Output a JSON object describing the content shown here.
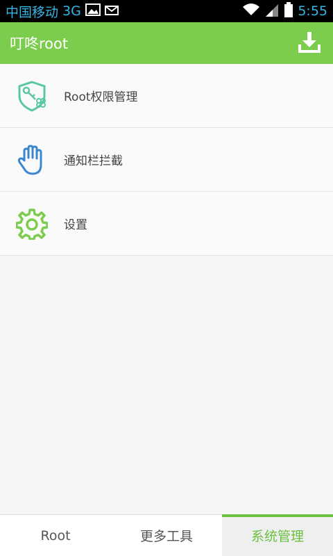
{
  "status_bar": {
    "carrier": "中国移动",
    "network": "3G",
    "time": "5:55",
    "icons": [
      "gallery-icon",
      "mail-icon",
      "wifi-icon",
      "signal-icon",
      "battery-icon"
    ]
  },
  "app_bar": {
    "title": "叮咚root",
    "action_icon": "download-icon"
  },
  "menu": {
    "items": [
      {
        "label": "Root权限管理",
        "icon": "shield-key-icon",
        "color": "#5ac8a0"
      },
      {
        "label": "通知栏拦截",
        "icon": "hand-icon",
        "color": "#3a86d0"
      },
      {
        "label": "设置",
        "icon": "gear-icon",
        "color": "#7ccc4e"
      }
    ]
  },
  "bottom_nav": {
    "tabs": [
      {
        "label": "Root",
        "active": false
      },
      {
        "label": "更多工具",
        "active": false
      },
      {
        "label": "系统管理",
        "active": true
      }
    ],
    "accent": "#6cc040"
  },
  "colors": {
    "app_bar": "#7ccc4e",
    "status_text": "#33b5e5"
  }
}
